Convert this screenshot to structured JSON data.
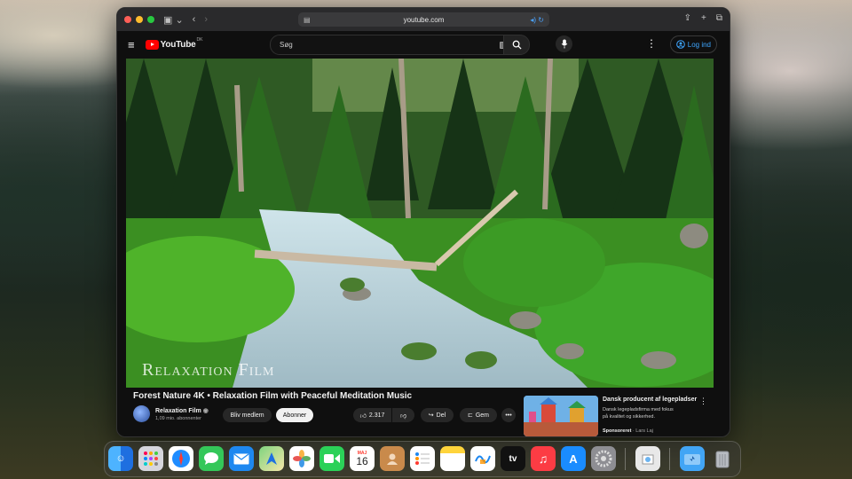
{
  "browser": {
    "url": "youtube.com",
    "light_colors": [
      "#ff5f57",
      "#febc2e",
      "#28c840"
    ]
  },
  "youtube": {
    "logo_text": "YouTube",
    "country_code": "DK",
    "search_placeholder": "Søg",
    "login_label": "Log ind"
  },
  "video": {
    "watermark": "Relaxation Film",
    "title": "Forest Nature 4K • Relaxation Film with Peaceful Meditation Music"
  },
  "channel": {
    "name": "Relaxation Film",
    "subscribers": "1,09 mio. abonnenter",
    "join_label": "Bliv medlem",
    "subscribe_label": "Abonner"
  },
  "actions": {
    "likes": "2.317",
    "share_label": "Del",
    "save_label": "Gem"
  },
  "ad": {
    "title": "Dansk producent af legepladser",
    "description": "Dansk legepladsfirma med fokus på kvalitet og sikkerhed.",
    "sponsored": "Sponsoreret",
    "advertiser": "Lars Laj"
  },
  "dock": {
    "calendar_month": "MAJ",
    "calendar_day": "16",
    "tv_label": "tv",
    "items": [
      "finder",
      "launchpad",
      "safari",
      "messages",
      "mail",
      "maps",
      "photos",
      "facetime",
      "calendar",
      "contacts",
      "reminders",
      "notes",
      "freeform",
      "tv",
      "music",
      "app-store",
      "system-settings",
      "preview",
      "downloads",
      "trash"
    ]
  }
}
